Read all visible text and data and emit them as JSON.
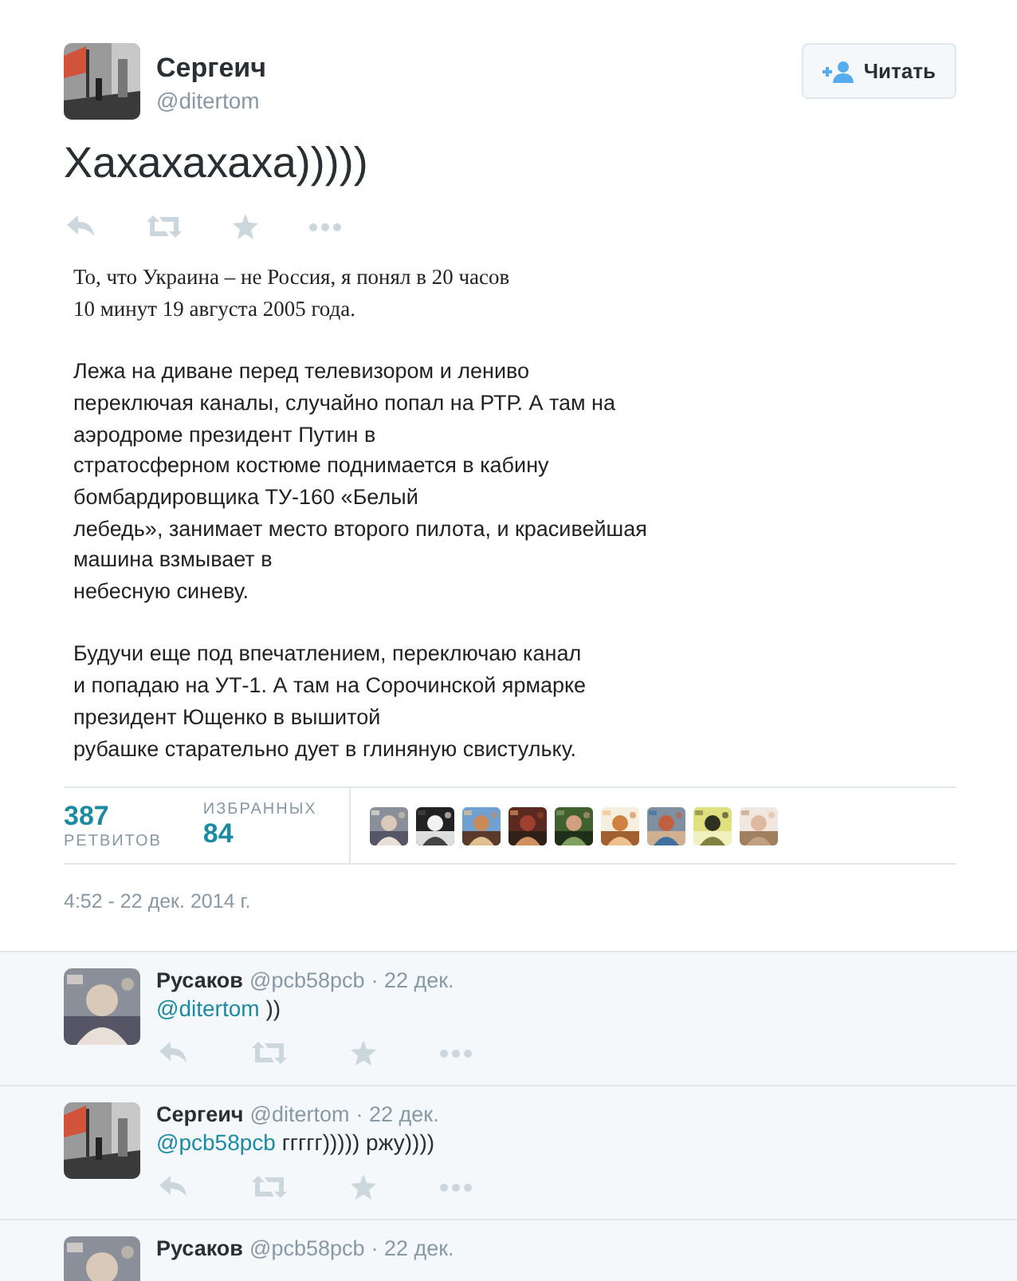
{
  "tweet": {
    "author": {
      "name": "Сергеич",
      "handle": "@ditertom"
    },
    "follow_button": {
      "label": "Читать"
    },
    "text": "Хахахахаха)))))",
    "attachment": {
      "paragraphs": [
        {
          "kind": "serif",
          "lines": [
            "То, что Украина – не Россия, я понял в 20 часов",
            "10 минут 19 августа 2005 года."
          ]
        },
        {
          "kind": "sans",
          "lines": [
            "Лежа на диване перед телевизором и лениво",
            "переключая каналы, случайно попал на РТР. А там на",
            "аэродроме президент Путин в",
            "стратосферном костюме поднимается в кабину",
            "бомбардировщика ТУ-160 «Белый",
            "лебедь», занимает место второго пилота, и красивейшая",
            "машина взмывает в",
            "небесную синеву."
          ]
        },
        {
          "kind": "sans",
          "lines": [
            "Будучи еще под впечатлением, переключаю канал",
            "и попадаю на УТ-1. А там на Сорочинской ярмарке",
            "президент Ющенко в вышитой",
            "рубашке старательно дует в глиняную свистульку."
          ]
        }
      ]
    },
    "stats": {
      "retweets": {
        "count": "387",
        "label": "РЕТВИТОВ"
      },
      "favorites": {
        "label": "ИЗБРАННЫХ",
        "count": "84"
      }
    },
    "timestamp": "4:52 - 22 дек. 2014 г."
  },
  "replies": [
    {
      "name": "Русаков",
      "handle": "@pcb58pcb",
      "date": "· 22 дек.",
      "mention": "@ditertom",
      "text": "))"
    },
    {
      "name": "Сергеич",
      "handle": "@ditertom",
      "date": "· 22 дек.",
      "mention": "@pcb58pcb",
      "text": "ггггг))))) ржу))))"
    },
    {
      "name": "Русаков",
      "handle": "@pcb58pcb",
      "date": "· 22 дек."
    }
  ]
}
